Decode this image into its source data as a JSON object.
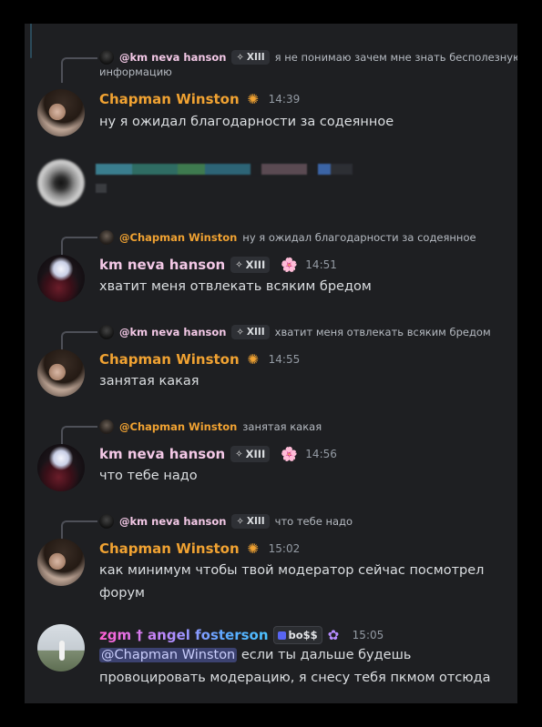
{
  "colors": {
    "chapman": "#f0a232",
    "km": "#f3c8e6",
    "timestamp": "#949ba4",
    "background": "#1e1f22"
  },
  "messages": [
    {
      "reply": {
        "name": "@km neva hanson",
        "tag": "XIII",
        "text": "я не понимаю зачем мне знать бесполезную",
        "text2": "информацию"
      },
      "author": "Chapman Winston",
      "badge": "gear-icon",
      "time": "14:39",
      "lines": [
        "ну я ожидал благодарности за содеянное"
      ]
    },
    {
      "reply": {
        "name": "@Chapman Winston",
        "text": "ну я ожидал благодарности за содеянное"
      },
      "author": "km neva hanson",
      "tag": "XIII",
      "badge": "flower-icon",
      "time": "14:51",
      "lines": [
        "хватит меня отвлекать всяким бредом"
      ]
    },
    {
      "reply": {
        "name": "@km neva hanson",
        "tag": "XIII",
        "text": "хватит меня отвлекать всяким бредом"
      },
      "author": "Chapman Winston",
      "badge": "gear-icon",
      "time": "14:55",
      "lines": [
        "занятая какая"
      ]
    },
    {
      "reply": {
        "name": "@Chapman Winston",
        "text": "занятая какая"
      },
      "author": "km neva hanson",
      "tag": "XIII",
      "badge": "flower-icon",
      "time": "14:56",
      "lines": [
        "что тебе надо"
      ]
    },
    {
      "reply": {
        "name": "@km neva hanson",
        "tag": "XIII",
        "text": "что тебе надо"
      },
      "author": "Chapman Winston",
      "badge": "gear-icon",
      "time": "15:02",
      "lines": [
        "как минимум чтобы твой модератор сейчас посмотрел",
        "форум"
      ]
    },
    {
      "author": "zgm † angel fosterson",
      "tag": "bo$$",
      "badge": "flower-icon",
      "time": "15:05",
      "mention": "@Chapman Winston",
      "line1_rest": " если ты дальше будешь",
      "line2": "провоцировать модерацию, я снесу тебя пкмом отсюда"
    }
  ]
}
